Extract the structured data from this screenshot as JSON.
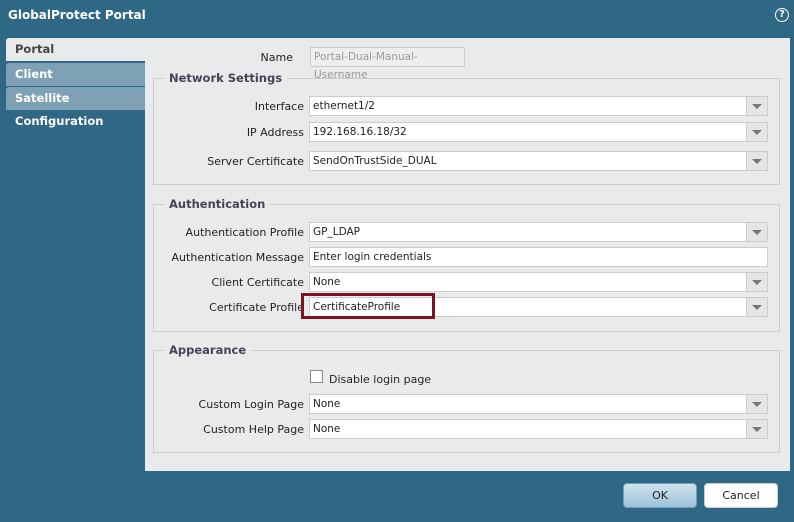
{
  "title": "GlobalProtect Portal",
  "help_icon": "?",
  "tabs": [
    "Portal Configuration",
    "Client Configuration",
    "Satellite Configuration"
  ],
  "name": {
    "label": "Name",
    "value": "Portal-Dual-Manual-Username"
  },
  "network": {
    "legend": "Network Settings",
    "interface_label": "Interface",
    "interface": "ethernet1/2",
    "ip_label": "IP Address",
    "ip": "192.168.16.18/32",
    "cert_label": "Server Certificate",
    "cert": "SendOnTrustSide_DUAL"
  },
  "auth": {
    "legend": "Authentication",
    "profile_label": "Authentication Profile",
    "profile": "GP_LDAP",
    "message_label": "Authentication Message",
    "message": "Enter login credentials",
    "client_cert_label": "Client Certificate",
    "client_cert": "None",
    "cert_profile_label": "Certificate Profile",
    "cert_profile": "CertificateProfile"
  },
  "appearance": {
    "legend": "Appearance",
    "disable_label": "Disable login page",
    "login_label": "Custom Login Page",
    "login": "None",
    "help_label": "Custom Help Page",
    "help": "None"
  },
  "buttons": {
    "ok": "OK",
    "cancel": "Cancel"
  }
}
